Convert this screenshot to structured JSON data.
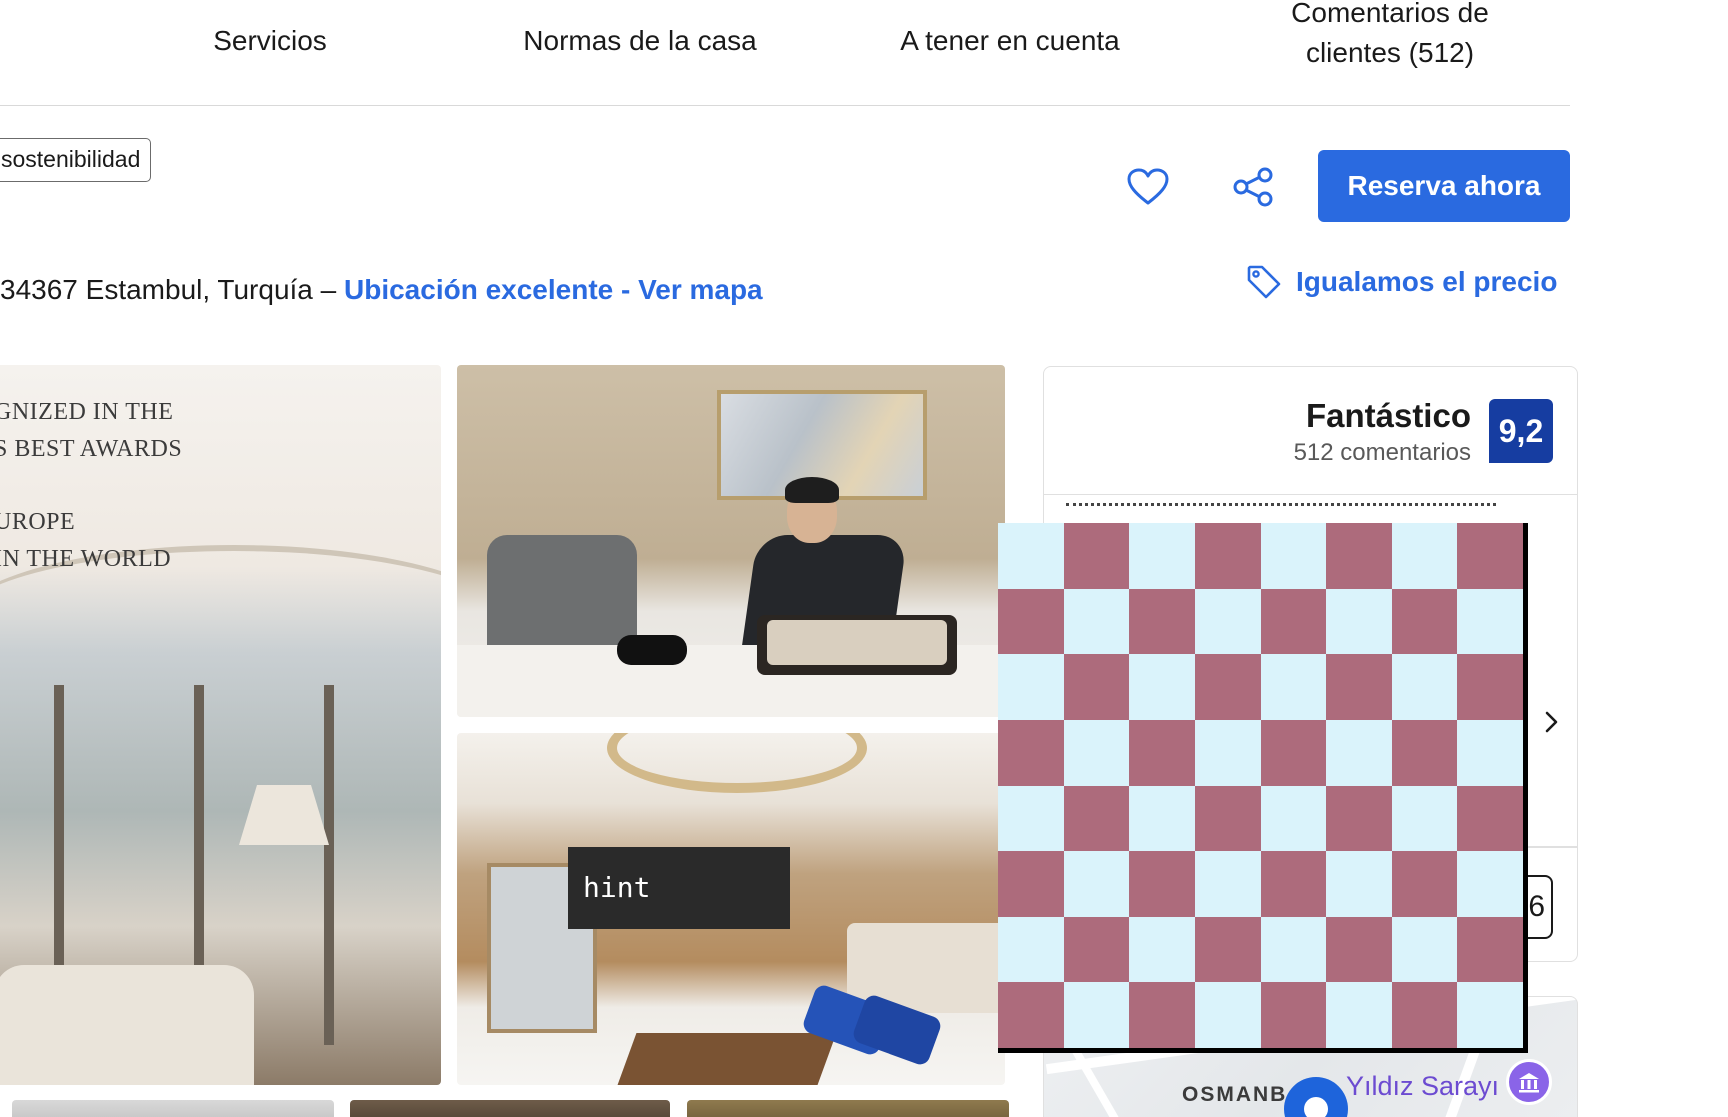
{
  "nav": {
    "items": [
      {
        "label": "Servicios"
      },
      {
        "label": "Normas de la casa"
      },
      {
        "label": "A tener en cuenta"
      },
      {
        "label": "Comentarios de\nclientes (512)"
      }
    ]
  },
  "badge": {
    "label": "sostenibilidad"
  },
  "actions": {
    "favorite_icon": "heart-icon",
    "share_icon": "share-icon",
    "reserve_label": "Reserva ahora"
  },
  "address": {
    "text": "34367 Estambul, Turquía – ",
    "link": "Ubicación excelente - Ver mapa"
  },
  "price_match": {
    "label": "Igualamos el precio",
    "icon": "price-tag-icon"
  },
  "photos": {
    "main_text": [
      "GNIZED IN THE",
      "S BEST AWARDS",
      "UROPE",
      " IN THE WORLD"
    ]
  },
  "tooltip": {
    "text": "hint"
  },
  "review": {
    "word": "Fantástico",
    "count": "512 comentarios",
    "score": "9,2",
    "sub_score_partial": "6"
  },
  "map": {
    "district": "OSMANB",
    "poi": "Yıldız Sarayı"
  },
  "colors": {
    "brand_blue": "#2a6ae0",
    "score_blue": "#163da1",
    "checker_light": "#daf3fb",
    "checker_dark": "#ad6b7c"
  }
}
